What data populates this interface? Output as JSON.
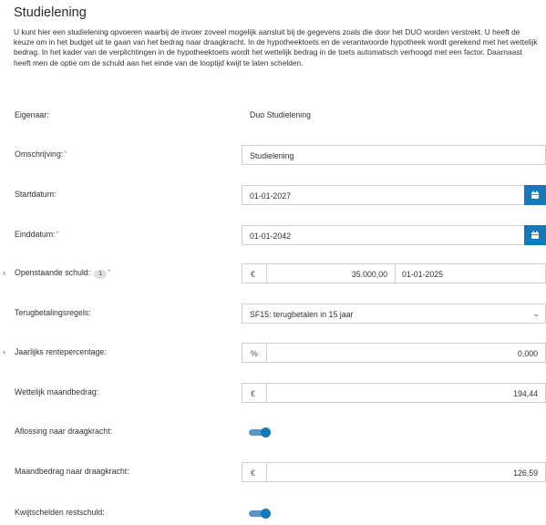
{
  "title": "Studielening",
  "intro": "U kunt hier een studielening opvoeren waarbij de invoer zoveel mogelijk aansluit bij de gegevens zoals die door het DUO worden verstrekt. U heeft de keuze om in het budget uit te gaan van het bedrag naar draagkracht. In de hypotheektoets en de verantwoorde hypotheek wordt gerekend met het wettelijk bedrag. In het kader van de verplichtingen in de hypotheektoets wordt het wettelijk bedrag in de toets automatisch verhoogd met een factor. Daarnaast heeft men de optie om de schuld aan het einde van de looptijd kwijt te laten schelden.",
  "fields": {
    "eigenaar": {
      "label": "Eigenaar:",
      "value": "Duo Studielening"
    },
    "omschrijving": {
      "label": "Omschrijving:",
      "required": "*",
      "value": "Studielening"
    },
    "startdatum": {
      "label": "Startdatum:",
      "value": "01-01-2027"
    },
    "einddatum": {
      "label": "Einddatum:",
      "required": "*",
      "value": "01-01-2042"
    },
    "openstaande_schuld": {
      "label": "Openstaande schuld:",
      "badge": "1",
      "required": "*",
      "currency": "€",
      "amount": "35.000,00",
      "date": "01-01-2025"
    },
    "terugbetalingsregels": {
      "label": "Terugbetalingsregels:",
      "value": "SF15: terugbetalen in 15 jaar"
    },
    "rentepercentage": {
      "label": "Jaarlijks rentepercentage:",
      "prefix": "%",
      "value": "0,000"
    },
    "wettelijk_maandbedrag": {
      "label": "Wettelijk maandbedrag:",
      "prefix": "€",
      "value": "194,44"
    },
    "aflossing_draagkracht": {
      "label": "Aflossing naar draagkracht:",
      "on": true
    },
    "maandbedrag_draagkracht": {
      "label": "Maandbedrag naar draagkracht:",
      "prefix": "€",
      "value": "126,59"
    },
    "kwijtschelden": {
      "label": "Kwijtschelden restschuld:",
      "on": true
    }
  },
  "icons": {
    "calendar": "calendar-icon",
    "expand": "chevron-right-icon",
    "dropdown": "chevron-down-icon"
  },
  "colors": {
    "accent": "#1479b8",
    "toggle_track": "#5a95c8"
  }
}
